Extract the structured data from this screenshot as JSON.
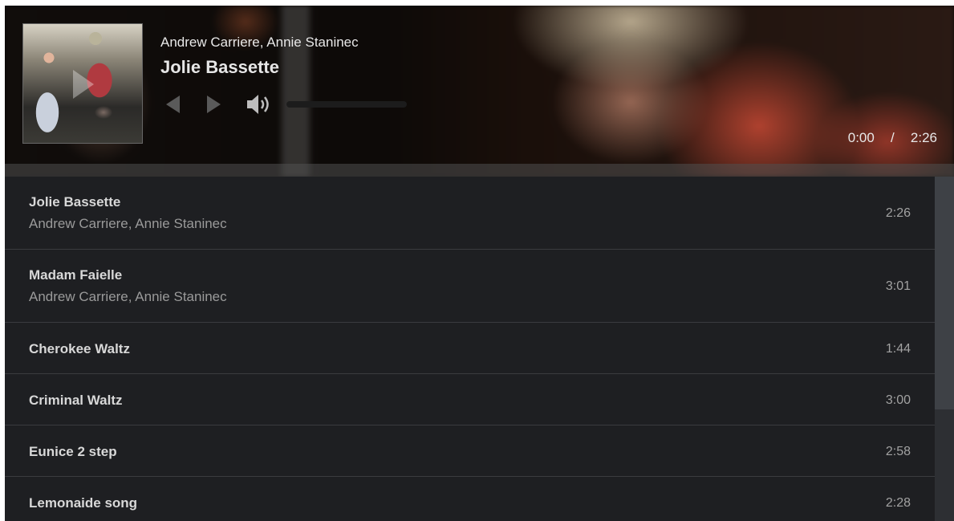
{
  "now_playing": {
    "artist": "Andrew Carriere, Annie Staninec",
    "title": "Jolie Bassette",
    "current_time": "0:00",
    "separator": "/",
    "duration": "2:26",
    "progress": 0
  },
  "controls": {
    "icons": [
      "previous-icon",
      "next-icon",
      "volume-icon"
    ]
  },
  "playlist": [
    {
      "title": "Jolie Bassette",
      "artist": "Andrew Carriere, Annie Staninec",
      "duration": "2:26"
    },
    {
      "title": "Madam Faielle",
      "artist": "Andrew Carriere, Annie Staninec",
      "duration": "3:01"
    },
    {
      "title": "Cherokee Waltz",
      "duration": "1:44"
    },
    {
      "title": "Criminal Waltz",
      "duration": "3:00"
    },
    {
      "title": "Eunice 2 step",
      "duration": "2:58"
    },
    {
      "title": "Lemonaide song",
      "duration": "2:28"
    }
  ],
  "colors": {
    "background": "#1e1f22",
    "divider": "#3a3b3f",
    "text_primary": "#d8d8d8",
    "text_secondary": "#9a9a9a"
  }
}
